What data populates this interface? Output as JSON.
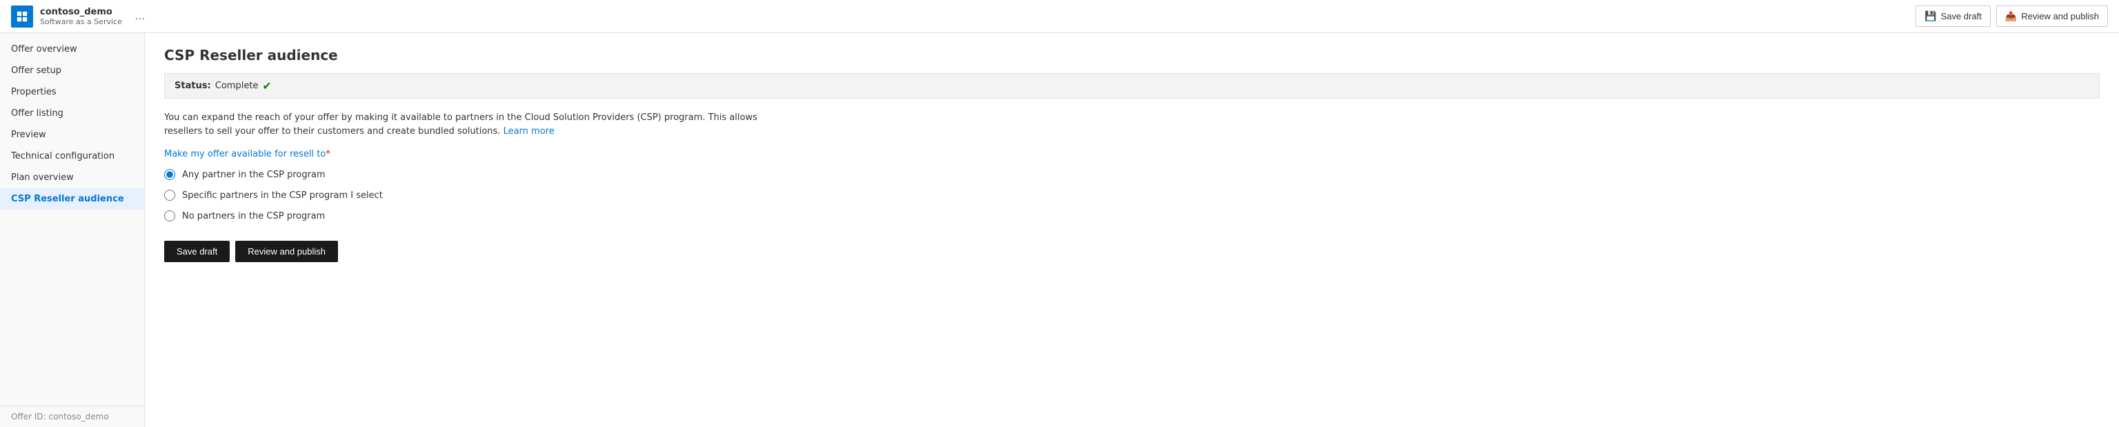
{
  "app": {
    "name": "contoso_demo",
    "subtitle": "Software as a Service",
    "icon_label": "app-icon"
  },
  "topbar": {
    "save_draft_label": "Save draft",
    "review_publish_label": "Review and publish",
    "ellipsis_label": "…"
  },
  "sidebar": {
    "items": [
      {
        "label": "Offer overview",
        "id": "offer-overview",
        "active": false
      },
      {
        "label": "Offer setup",
        "id": "offer-setup",
        "active": false
      },
      {
        "label": "Properties",
        "id": "properties",
        "active": false
      },
      {
        "label": "Offer listing",
        "id": "offer-listing",
        "active": false
      },
      {
        "label": "Preview",
        "id": "preview",
        "active": false
      },
      {
        "label": "Technical configuration",
        "id": "technical-configuration",
        "active": false
      },
      {
        "label": "Plan overview",
        "id": "plan-overview",
        "active": false
      },
      {
        "label": "CSP Reseller audience",
        "id": "csp-reseller-audience",
        "active": true
      }
    ],
    "offer_id_label": "Offer ID: contoso_demo"
  },
  "main": {
    "page_title": "CSP Reseller audience",
    "status_label": "Status:",
    "status_value": "Complete",
    "description": "You can expand the reach of your offer by making it available to partners in the Cloud Solution Providers (CSP) program. This allows resellers to sell your offer to their customers and create bundled solutions.",
    "learn_more_label": "Learn more",
    "resell_label": "Make my offer available for resell to",
    "required_marker": "*",
    "radio_options": [
      {
        "id": "any-partner",
        "label": "Any partner in the CSP program",
        "checked": true
      },
      {
        "id": "specific-partners",
        "label": "Specific partners in the CSP program I select",
        "checked": false
      },
      {
        "id": "no-partners",
        "label": "No partners in the CSP program",
        "checked": false
      }
    ],
    "save_draft_btn": "Save draft",
    "review_publish_btn": "Review and publish"
  }
}
